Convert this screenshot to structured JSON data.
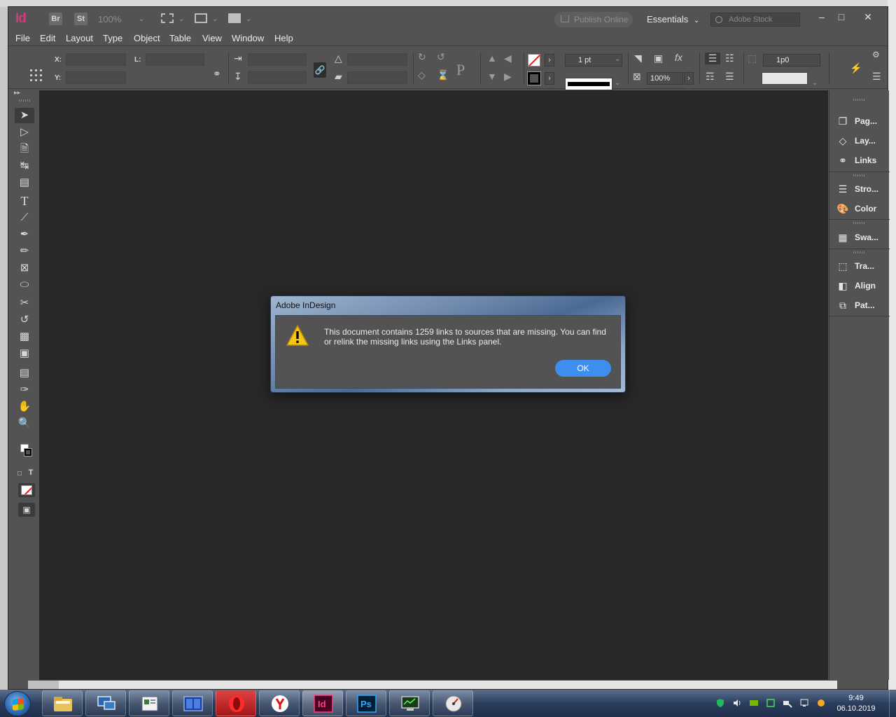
{
  "app": {
    "logo": "Id",
    "bridge_badge": "Br",
    "stock_badge": "St",
    "zoom": "100%",
    "publish_label": "Publish Online",
    "workspace_label": "Essentials",
    "search_placeholder": "Adobe Stock"
  },
  "menu": [
    "File",
    "Edit",
    "Layout",
    "Type",
    "Object",
    "Table",
    "View",
    "Window",
    "Help"
  ],
  "control": {
    "x_label": "X:",
    "y_label": "Y:",
    "l_label": "L:",
    "stroke_weight": "1 pt",
    "opacity": "100%",
    "offset": "1p0"
  },
  "panels": [
    {
      "label": "Pag...",
      "icon": "pages-icon"
    },
    {
      "label": "Lay...",
      "icon": "layers-icon"
    },
    {
      "label": "Links",
      "icon": "links-icon"
    },
    {
      "label": "Stro...",
      "icon": "stroke-icon"
    },
    {
      "label": "Color",
      "icon": "color-icon"
    },
    {
      "label": "Swa...",
      "icon": "swatches-icon"
    },
    {
      "label": "Tra...",
      "icon": "transform-icon"
    },
    {
      "label": "Align",
      "icon": "align-icon"
    },
    {
      "label": "Pat...",
      "icon": "pathfinder-icon"
    }
  ],
  "dialog": {
    "title": "Adobe InDesign",
    "message": "This document contains 1259 links to sources that are missing. You can find or relink the missing links using the Links panel.",
    "ok_label": "OK"
  },
  "taskbar": {
    "time": "9:49",
    "date": "06.10.2019",
    "apps": [
      "file-explorer-icon",
      "network-icon",
      "document-icon",
      "file-manager-icon",
      "opera-icon",
      "yandex-icon",
      "indesign-icon",
      "photoshop-icon",
      "monitor-icon",
      "speedometer-icon"
    ]
  },
  "colors": {
    "accent": "#3e8ef0",
    "indesign_brand": "#d4397a",
    "photoshop_brand": "#31a8ff",
    "panel_bg": "#535353",
    "canvas_bg": "#282828"
  }
}
